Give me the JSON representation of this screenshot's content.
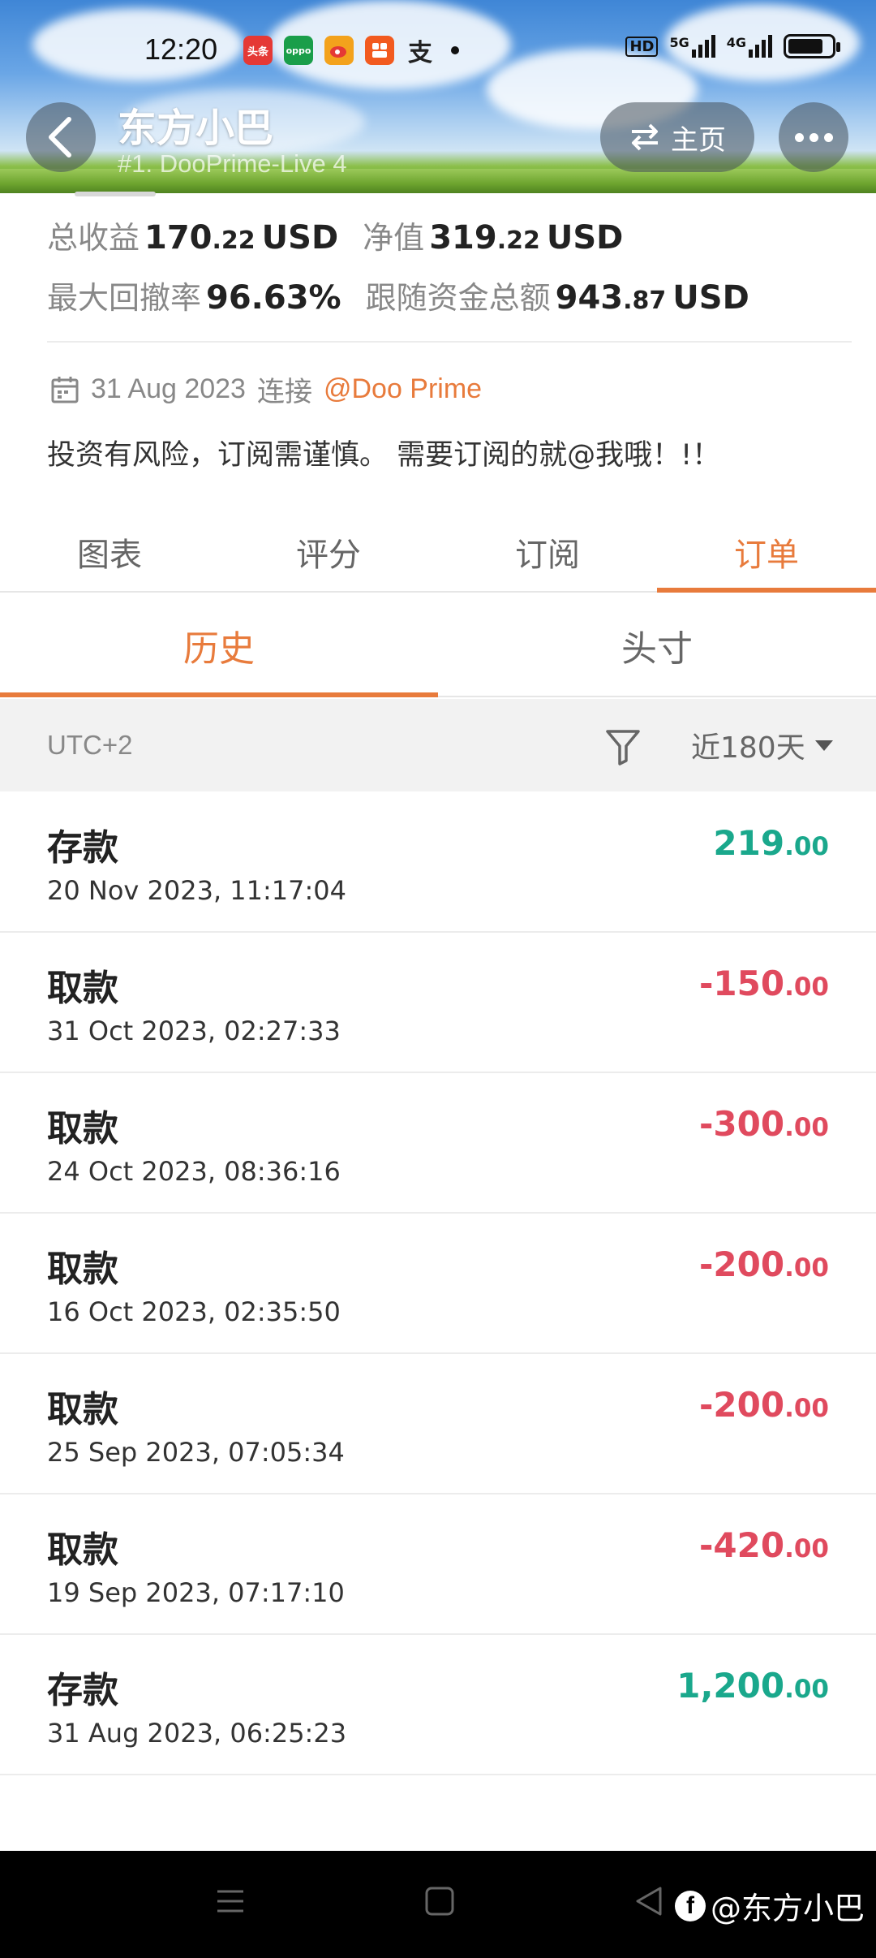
{
  "status_bar": {
    "time": "12:20",
    "apps": [
      {
        "icon": "toutiao-icon",
        "label": "头条",
        "color": "#e53935"
      },
      {
        "icon": "oppo-icon",
        "label": "oppo",
        "color": "#1a9e4a"
      },
      {
        "icon": "weibo-icon",
        "label": "",
        "color": "#f3a21c"
      },
      {
        "icon": "taobao-icon",
        "label": "",
        "color": "#f25a1f"
      },
      {
        "icon": "alipay-icon",
        "label": "支",
        "color": "#222222"
      }
    ],
    "network": "5G",
    "network2": "4G",
    "hd": "HD"
  },
  "header": {
    "title": "东方小巴",
    "subtitle": "#1. DooPrime-Live 4",
    "home_label": "主页"
  },
  "summary": {
    "total_profit_label": "总收益",
    "total_profit_int": "170",
    "total_profit_dec": ".22",
    "total_profit_unit": "USD",
    "equity_label": "净值",
    "equity_int": "319",
    "equity_dec": ".22",
    "equity_unit": "USD",
    "max_drawdown_label": "最大回撤率",
    "max_drawdown": "96.63%",
    "follow_funds_label": "跟随资金总额",
    "follow_funds_int": "943",
    "follow_funds_dec": ".87",
    "follow_funds_unit": "USD"
  },
  "profile": {
    "connect_date": "31 Aug 2023",
    "connect_label": "连接",
    "broker": "@Doo Prime",
    "bio": "投资有风险，订阅需谨慎。 需要订阅的就@我哦！!！"
  },
  "main_tabs": [
    {
      "label": "图表",
      "active": false
    },
    {
      "label": "评分",
      "active": false
    },
    {
      "label": "订阅",
      "active": false
    },
    {
      "label": "订单",
      "active": true
    }
  ],
  "sub_tabs": [
    {
      "label": "历史",
      "active": true
    },
    {
      "label": "头寸",
      "active": false
    }
  ],
  "filter": {
    "timezone": "UTC+2",
    "range": "近180天"
  },
  "transactions": [
    {
      "type": "存款",
      "time": "20 Nov 2023, 11:17:04",
      "amount_int": "219",
      "amount_dec": ".00",
      "sign": "pos"
    },
    {
      "type": "取款",
      "time": "31 Oct 2023, 02:27:33",
      "amount_int": "-150",
      "amount_dec": ".00",
      "sign": "neg"
    },
    {
      "type": "取款",
      "time": "24 Oct 2023, 08:36:16",
      "amount_int": "-300",
      "amount_dec": ".00",
      "sign": "neg"
    },
    {
      "type": "取款",
      "time": "16 Oct 2023, 02:35:50",
      "amount_int": "-200",
      "amount_dec": ".00",
      "sign": "neg"
    },
    {
      "type": "取款",
      "time": "25 Sep 2023, 07:05:34",
      "amount_int": "-200",
      "amount_dec": ".00",
      "sign": "neg"
    },
    {
      "type": "取款",
      "time": "19 Sep 2023, 07:17:10",
      "amount_int": "-420",
      "amount_dec": ".00",
      "sign": "neg"
    },
    {
      "type": "存款",
      "time": "31 Aug 2023, 06:25:23",
      "amount_int": "1,200",
      "amount_dec": ".00",
      "sign": "pos"
    }
  ],
  "watermark": {
    "text": "@东方小巴"
  },
  "colors": {
    "accent": "#e87b3c",
    "positive": "#1aa88c",
    "negative": "#e04a5e"
  }
}
